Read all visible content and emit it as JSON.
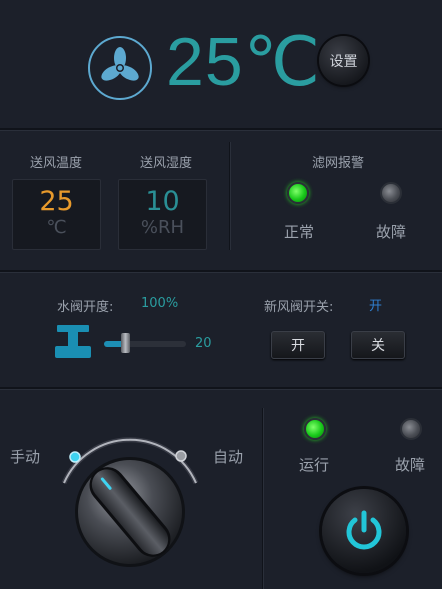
{
  "header": {
    "temperature": "25℃",
    "settings_label": "设置"
  },
  "supply": {
    "temp_label": "送风温度",
    "temp_value": "25",
    "temp_unit": "℃",
    "humidity_label": "送风湿度",
    "humidity_value": "10",
    "humidity_unit": "%RH"
  },
  "filter_alarm": {
    "title": "滤网报警",
    "normal_label": "正常",
    "fault_label": "故障",
    "normal_on": true,
    "fault_on": false
  },
  "water_valve": {
    "label": "水阀开度:",
    "percent": "100%",
    "slider_value": "20"
  },
  "fresh_air_valve": {
    "label": "新风阀开关:",
    "state": "开",
    "open_label": "开",
    "close_label": "关"
  },
  "mode": {
    "manual_label": "手动",
    "auto_label": "自动"
  },
  "run_status": {
    "running_label": "运行",
    "fault_label": "故障",
    "running_on": true,
    "fault_on": false
  },
  "colors": {
    "accent_teal": "#2a9da0",
    "temp_orange": "#e89a2c",
    "humidity_teal": "#2a8f95",
    "value_blue": "#2f7fd0",
    "led_green": "#18c81a",
    "power_cyan": "#22c6d8"
  },
  "icons": {
    "fan": "fan-icon",
    "valve": "valve-icon",
    "power": "power-icon"
  }
}
